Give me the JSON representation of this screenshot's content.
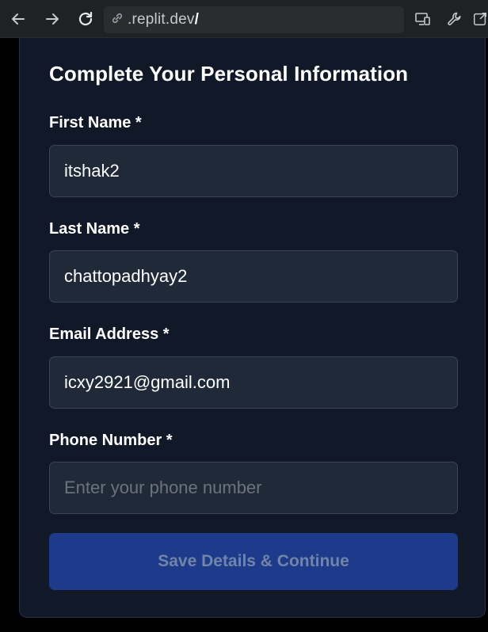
{
  "browser": {
    "address": ".replit.dev",
    "address_slash": "/",
    "icons": [
      "back-arrow-icon",
      "forward-arrow-icon",
      "reload-icon",
      "link-icon",
      "cast-devices-icon",
      "wrench-icon",
      "open-external-icon"
    ]
  },
  "form": {
    "title": "Complete Your Personal Information",
    "fields": [
      {
        "label": "First Name *",
        "value": "itshak2",
        "placeholder": ""
      },
      {
        "label": "Last Name *",
        "value": "chattopadhyay2",
        "placeholder": ""
      },
      {
        "label": "Email Address *",
        "value": "icxy2921@gmail.com",
        "placeholder": ""
      },
      {
        "label": "Phone Number *",
        "value": "",
        "placeholder": "Enter your phone number"
      }
    ],
    "submit_label": "Save Details & Continue"
  },
  "colors": {
    "page_bg": "#000000",
    "card_bg": "#111827",
    "input_bg": "#1f2937",
    "button_bg": "#1e3a8a",
    "button_text": "#7185a8"
  }
}
